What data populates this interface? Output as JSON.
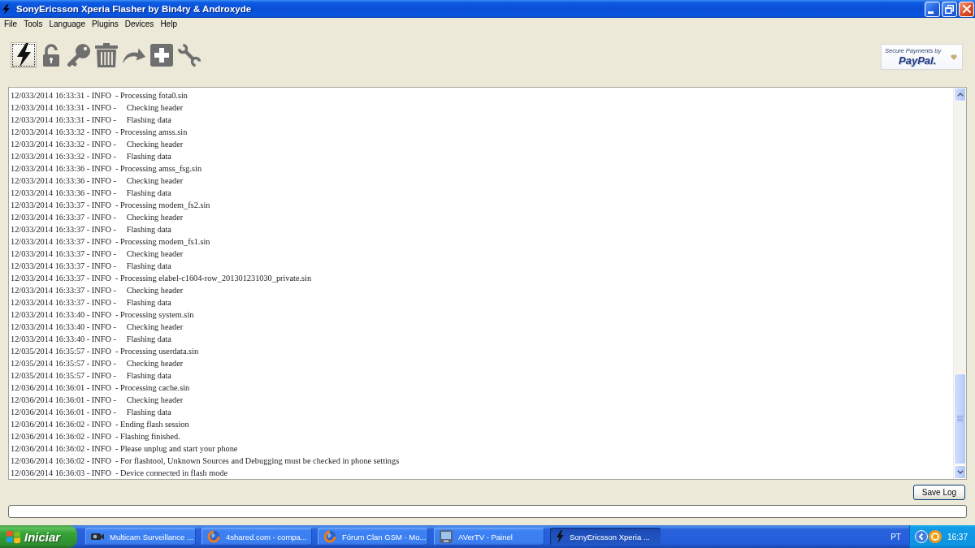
{
  "window": {
    "title": "SonyEricsson Xperia Flasher by Bin4ry & Androxyde"
  },
  "menu": [
    "File",
    "Tools",
    "Language",
    "Plugins",
    "Devices",
    "Help"
  ],
  "toolbar": [
    {
      "focused": true
    },
    {
      "focused": false
    },
    {
      "focused": false
    },
    {
      "focused": false
    },
    {
      "focused": false
    },
    {
      "focused": false
    },
    {
      "focused": false
    }
  ],
  "payment_badge": {
    "caption": "Secure Payments by",
    "logo_text": "PayPal."
  },
  "log": {
    "lines": [
      "12/033/2014 16:33:31 - INFO  - Processing fota0.sin",
      "12/033/2014 16:33:31 - INFO -     Checking header",
      "12/033/2014 16:33:31 - INFO -     Flashing data",
      "12/033/2014 16:33:32 - INFO  - Processing amss.sin",
      "12/033/2014 16:33:32 - INFO -     Checking header",
      "12/033/2014 16:33:32 - INFO -     Flashing data",
      "12/033/2014 16:33:36 - INFO  - Processing amss_fsg.sin",
      "12/033/2014 16:33:36 - INFO -     Checking header",
      "12/033/2014 16:33:36 - INFO -     Flashing data",
      "12/033/2014 16:33:37 - INFO  - Processing modem_fs2.sin",
      "12/033/2014 16:33:37 - INFO -     Checking header",
      "12/033/2014 16:33:37 - INFO -     Flashing data",
      "12/033/2014 16:33:37 - INFO  - Processing modem_fs1.sin",
      "12/033/2014 16:33:37 - INFO -     Checking header",
      "12/033/2014 16:33:37 - INFO -     Flashing data",
      "12/033/2014 16:33:37 - INFO  - Processing elabel-c1604-row_201301231030_private.sin",
      "12/033/2014 16:33:37 - INFO -     Checking header",
      "12/033/2014 16:33:37 - INFO -     Flashing data",
      "12/033/2014 16:33:40 - INFO  - Processing system.sin",
      "12/033/2014 16:33:40 - INFO -     Checking header",
      "12/033/2014 16:33:40 - INFO -     Flashing data",
      "12/035/2014 16:35:57 - INFO  - Processing userdata.sin",
      "12/035/2014 16:35:57 - INFO -     Checking header",
      "12/035/2014 16:35:57 - INFO -     Flashing data",
      "12/036/2014 16:36:01 - INFO  - Processing cache.sin",
      "12/036/2014 16:36:01 - INFO -     Checking header",
      "12/036/2014 16:36:01 - INFO -     Flashing data",
      "12/036/2014 16:36:02 - INFO  - Ending flash session",
      "12/036/2014 16:36:02 - INFO  - Flashing finished.",
      "12/036/2014 16:36:02 - INFO  - Please unplug and start your phone",
      "12/036/2014 16:36:02 - INFO  - For flashtool, Unknown Sources and Debugging must be checked in phone settings",
      "12/036/2014 16:36:03 - INFO  - Device connected in flash mode"
    ]
  },
  "save_button": {
    "label": "Save Log"
  },
  "progress": {
    "level": 0
  },
  "taskbar": {
    "start_button": "Iniciar",
    "tasks": [
      {
        "label": "Multicam Surveillance ...",
        "selected": false
      },
      {
        "label": "4shared.com - compa...",
        "selected": false
      },
      {
        "label": "Fórum Clan GSM - Mo...",
        "selected": false
      },
      {
        "label": "AVerTV - Painel",
        "selected": false
      },
      {
        "label": "SonyEricsson Xperia ...",
        "selected": true
      }
    ],
    "language": "PT",
    "clock": "16:37"
  }
}
